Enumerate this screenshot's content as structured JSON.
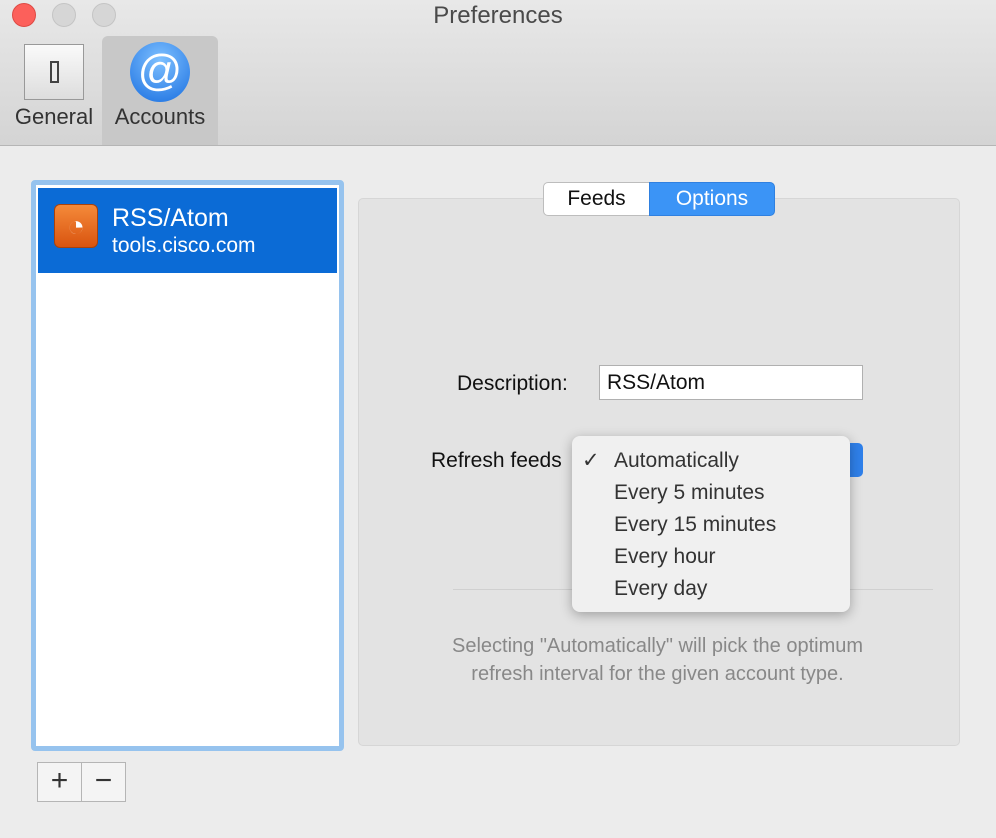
{
  "window": {
    "title": "Preferences"
  },
  "toolbar": {
    "items": [
      {
        "label": "General",
        "icon": "light-switch-icon"
      },
      {
        "label": "Accounts",
        "icon": "at-sign-icon",
        "selected": true
      }
    ]
  },
  "accounts": {
    "items": [
      {
        "name": "RSS/Atom",
        "server": "tools.cisco.com",
        "icon": "rss-icon"
      }
    ],
    "add_label": "+",
    "remove_label": "−"
  },
  "tabs": [
    {
      "label": "Feeds"
    },
    {
      "label": "Options",
      "selected": true
    }
  ],
  "options": {
    "description_label": "Description:",
    "description_value": "RSS/Atom",
    "refresh_label": "Refresh feeds",
    "refresh_options": [
      "Automatically",
      "Every 5 minutes",
      "Every 15 minutes",
      "Every hour",
      "Every day"
    ],
    "refresh_selected": "Automatically",
    "check_mark": "✓",
    "help_line1": "Selecting \"Automatically\" will pick the optimum",
    "help_line2": "refresh interval for the given account type."
  },
  "colors": {
    "accent": "#0b6bd6",
    "close": "#fc605b"
  }
}
